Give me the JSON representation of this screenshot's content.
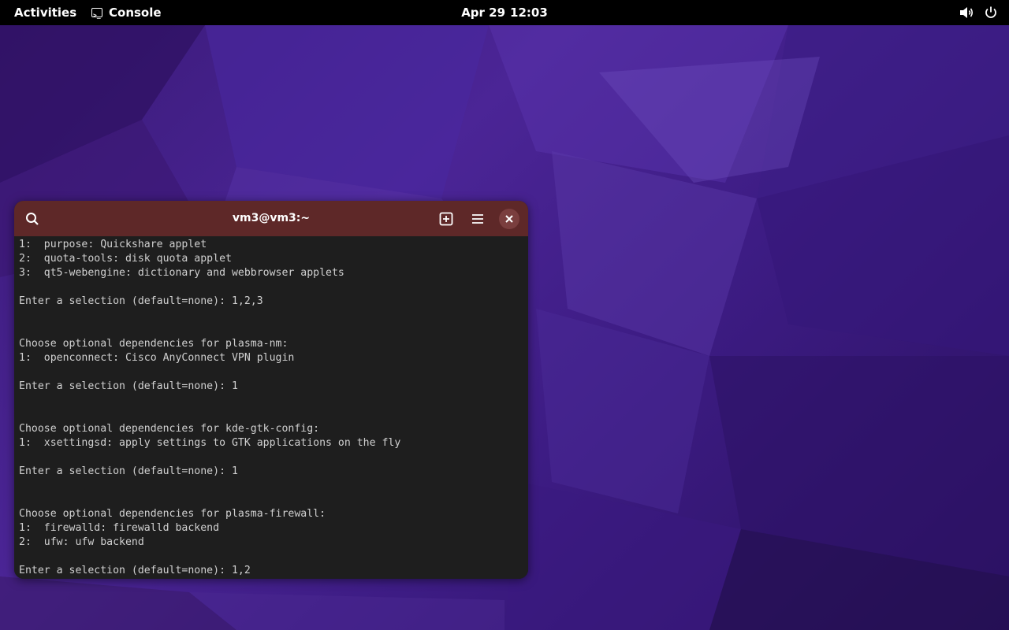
{
  "topbar": {
    "activities": "Activities",
    "app_name": "Console",
    "app_icon": "terminal-icon",
    "date": "Apr 29",
    "time": "12:03",
    "tray_icons": [
      "volume-icon",
      "power-icon"
    ]
  },
  "window": {
    "title": "vm3@vm3:~",
    "header_color": "#5e2828",
    "buttons": [
      "search-icon",
      "new-tab-icon",
      "hamburger-menu-icon",
      "close-icon"
    ]
  },
  "terminal": {
    "lines": [
      "1:  purpose: Quickshare applet",
      "2:  quota-tools: disk quota applet",
      "3:  qt5-webengine: dictionary and webbrowser applets",
      "",
      "Enter a selection (default=none): 1,2,3",
      "",
      "",
      "Choose optional dependencies for plasma-nm:",
      "1:  openconnect: Cisco AnyConnect VPN plugin",
      "",
      "Enter a selection (default=none): 1",
      "",
      "",
      "Choose optional dependencies for kde-gtk-config:",
      "1:  xsettingsd: apply settings to GTK applications on the fly",
      "",
      "Enter a selection (default=none): 1",
      "",
      "",
      "Choose optional dependencies for plasma-firewall:",
      "1:  firewalld: firewalld backend",
      "2:  ufw: ufw backend",
      "",
      "Enter a selection (default=none): 1,2"
    ]
  }
}
